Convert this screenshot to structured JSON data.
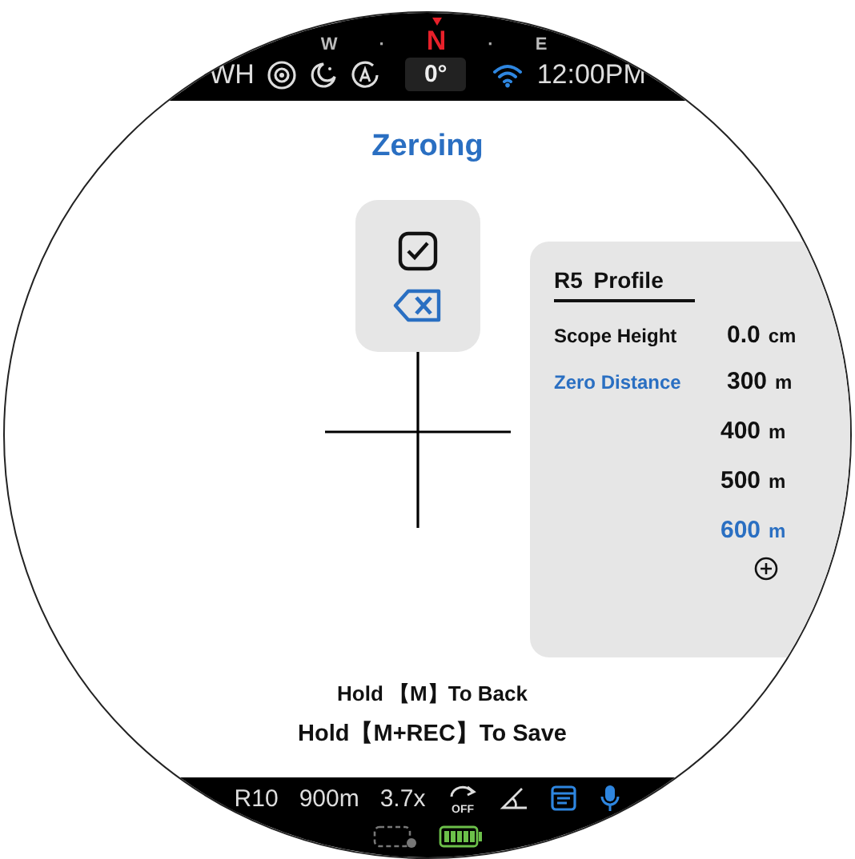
{
  "compass": {
    "marks": [
      {
        "label": "W",
        "kind": "letter"
      },
      {
        "label": "·",
        "kind": "dot"
      },
      {
        "label": "N",
        "kind": "north"
      },
      {
        "label": "·",
        "kind": "dot"
      },
      {
        "label": "E",
        "kind": "letter"
      }
    ]
  },
  "status_bar": {
    "mode": "WH",
    "heading": "0°",
    "time": "12:00PM"
  },
  "title": "Zeroing",
  "actions": [
    {
      "kind": "confirm"
    },
    {
      "kind": "delete"
    }
  ],
  "panel": {
    "title": "R5 Profile",
    "rows": [
      {
        "label": "Scope Height",
        "selected": false,
        "value": "0.0",
        "unit": "cm"
      },
      {
        "label": "Zero Distance",
        "selected": true,
        "value": "300",
        "unit": "m"
      }
    ],
    "options": [
      {
        "value": "400",
        "unit": "m",
        "selected": false
      },
      {
        "value": "500",
        "unit": "m",
        "selected": false
      },
      {
        "value": "600",
        "unit": "m",
        "selected": true
      }
    ]
  },
  "hints": [
    "Hold 【M】To Back",
    "Hold【M+REC】To Save"
  ],
  "bottom_bar": {
    "items": [
      "R10",
      "900m",
      "3.7x"
    ],
    "rotate_label": "OFF"
  }
}
